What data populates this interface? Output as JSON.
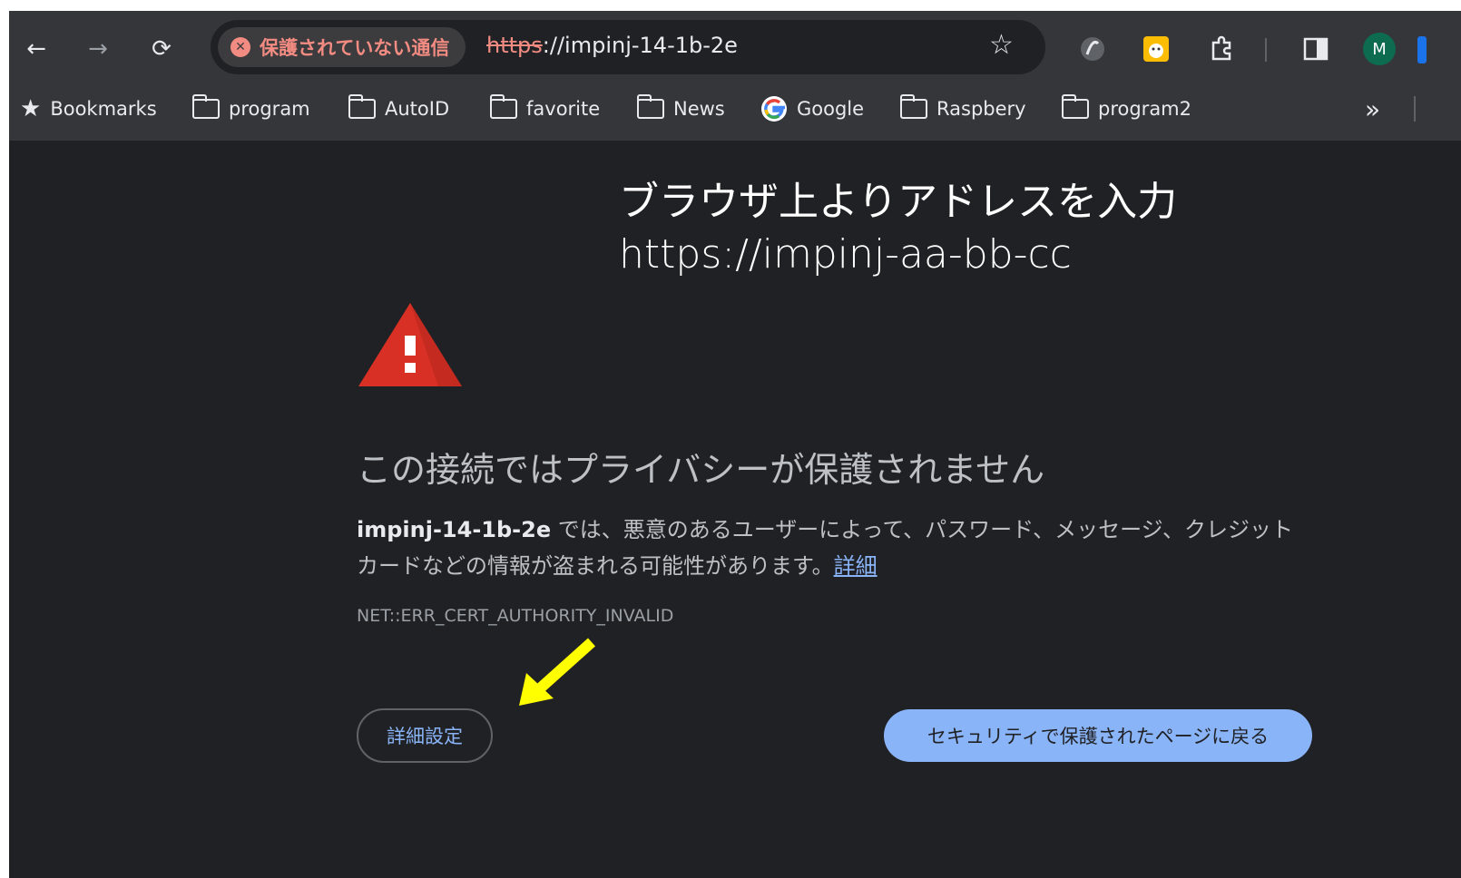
{
  "toolbar": {
    "security_chip": "保護されていない通信",
    "url_scheme": "https",
    "url_rest": "://impinj-14-1b-2e",
    "profile_initial": "M"
  },
  "bookmarks": {
    "items": [
      {
        "label": "Bookmarks",
        "icon": "star-icon"
      },
      {
        "label": "program",
        "icon": "folder-icon"
      },
      {
        "label": "AutoID",
        "icon": "folder-icon"
      },
      {
        "label": "favorite",
        "icon": "folder-icon"
      },
      {
        "label": "News",
        "icon": "folder-icon"
      },
      {
        "label": "Google",
        "icon": "google-icon"
      },
      {
        "label": "Raspbery",
        "icon": "folder-icon"
      },
      {
        "label": "program2",
        "icon": "folder-icon"
      }
    ],
    "overflow": "»"
  },
  "annotation": {
    "line1": "ブラウザ上よりアドレスを入力",
    "line2": "https://impinj-aa-bb-cc"
  },
  "interstitial": {
    "heading": "この接続ではプライバシーが保護されません",
    "host": "impinj-14-1b-2e",
    "body_text": " では、悪意のあるユーザーによって、パスワード、メッセージ、クレジット カードなどの情報が盗まれる可能性があります。",
    "details_link": "詳細",
    "error_code": "NET::ERR_CERT_AUTHORITY_INVALID",
    "advanced_button": "詳細設定",
    "back_button": "セキュリティで保護されたページに戻る"
  },
  "colors": {
    "page_bg": "#202124",
    "toolbar_bg": "#35363a",
    "danger": "#f28b82",
    "link": "#8ab4f8",
    "warning_red": "#d93025",
    "arrow_yellow": "#ffff00"
  }
}
